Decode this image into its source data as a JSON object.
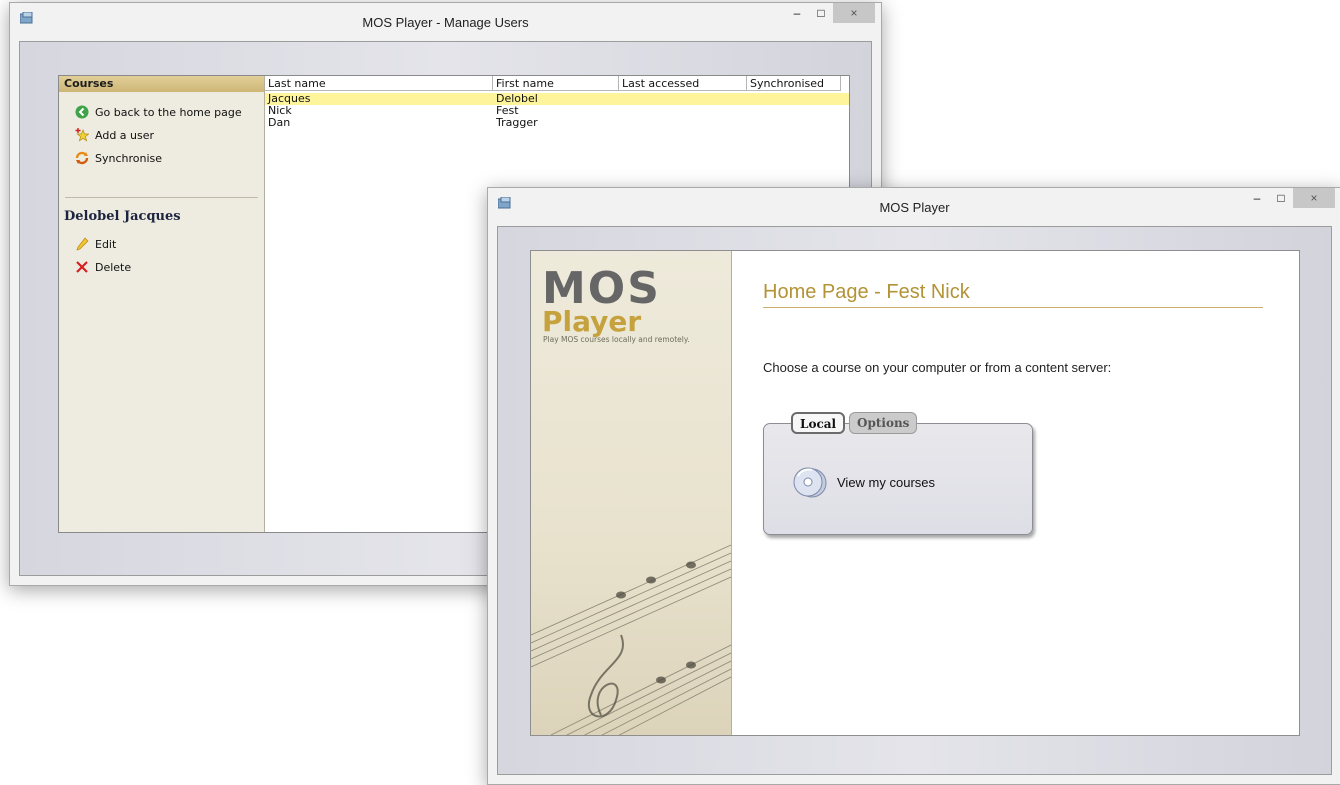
{
  "manage_window": {
    "title": "MOS Player - Manage Users",
    "controls": {
      "minimize": "–",
      "maximize": "□",
      "close": "×"
    },
    "sidebar": {
      "header": "Courses",
      "links": [
        {
          "label": "Go back to the home page",
          "icon": "arrow-left-icon"
        },
        {
          "label": "Add a user",
          "icon": "add-user-icon"
        },
        {
          "label": "Synchronise",
          "icon": "sync-icon"
        }
      ],
      "user_title": "Delobel Jacques",
      "user_actions": [
        {
          "label": "Edit",
          "icon": "pencil-icon"
        },
        {
          "label": "Delete",
          "icon": "delete-icon"
        }
      ]
    },
    "table": {
      "columns": [
        "Last name",
        "First name",
        "Last accessed",
        "Synchronised"
      ],
      "rows": [
        {
          "last": "Jacques",
          "first": "Delobel",
          "accessed": "",
          "sync": "",
          "selected": true
        },
        {
          "last": "Nick",
          "first": "Fest",
          "accessed": "",
          "sync": "",
          "selected": false
        },
        {
          "last": "Dan",
          "first": "Tragger",
          "accessed": "",
          "sync": "",
          "selected": false
        }
      ]
    }
  },
  "home_window": {
    "title": "MOS Player",
    "controls": {
      "minimize": "–",
      "maximize": "□",
      "close": "×"
    },
    "logo": {
      "mos": "MOS",
      "player": "Player",
      "tagline": "Play MOS courses locally and remotely."
    },
    "heading": "Home Page - Fest Nick",
    "prompt": "Choose a course on your computer or from a content server:",
    "tabs": [
      {
        "label": "Local",
        "active": true
      },
      {
        "label": "Options",
        "active": false
      }
    ],
    "view_courses": "View my courses"
  },
  "colors": {
    "accent_gold": "#b39336",
    "selection": "#fdf49b",
    "sidebar_header": "#cdb676"
  }
}
